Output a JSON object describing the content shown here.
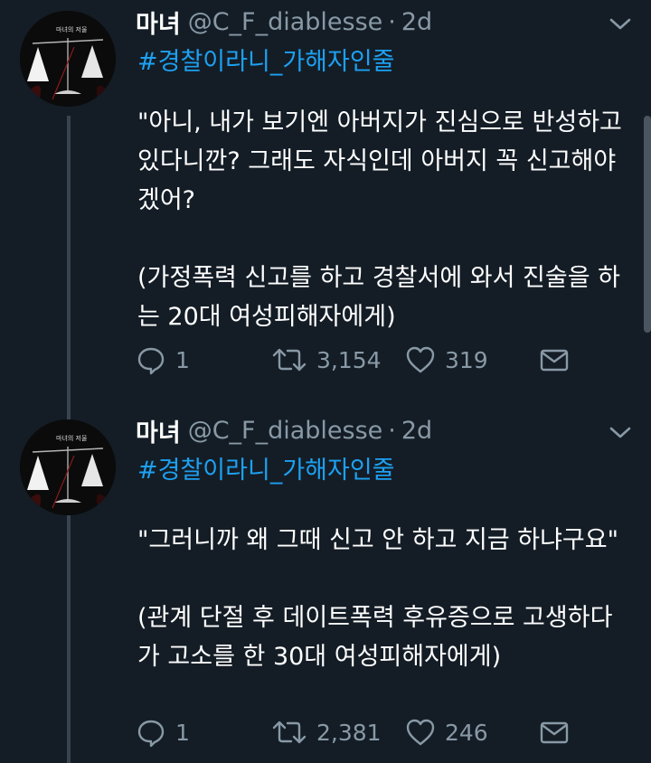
{
  "tweets": [
    {
      "name": "마녀",
      "handle": "@C_F_diablesse",
      "dot": "·",
      "time": "2d",
      "hashtag": "#경찰이라니_가해자인줄",
      "paragraphs": [
        "\"아니, 내가 보기엔 아버지가 진심으로 반성하고 있다니깐? 그래도 자식인데 아버지 꼭 신고해야겠어?",
        "(가정폭력 신고를 하고 경찰서에 와서 진술을 하는 20대 여성피해자에게)"
      ],
      "replies": "1",
      "retweets": "3,154",
      "likes": "319",
      "avatar_text": "마녀의 저울"
    },
    {
      "name": "마녀",
      "handle": "@C_F_diablesse",
      "dot": "·",
      "time": "2d",
      "hashtag": "#경찰이라니_가해자인줄",
      "paragraphs": [
        "\"그러니까 왜 그때 신고 안 하고 지금 하냐구요\"",
        "(관계 단절 후 데이트폭력 후유증으로 고생하다가 고소를 한 30대 여성피해자에게)"
      ],
      "replies": "1",
      "retweets": "2,381",
      "likes": "246",
      "avatar_text": "마녀의 저울"
    }
  ],
  "icons": {
    "reply": "reply-icon",
    "retweet": "retweet-icon",
    "like": "heart-icon",
    "dm": "envelope-icon",
    "menu": "chevron-down-icon"
  },
  "colors": {
    "background": "#141d26",
    "hashtag": "#1da1f2",
    "secondary_text": "#8899a6",
    "thread_line": "#37444f"
  }
}
